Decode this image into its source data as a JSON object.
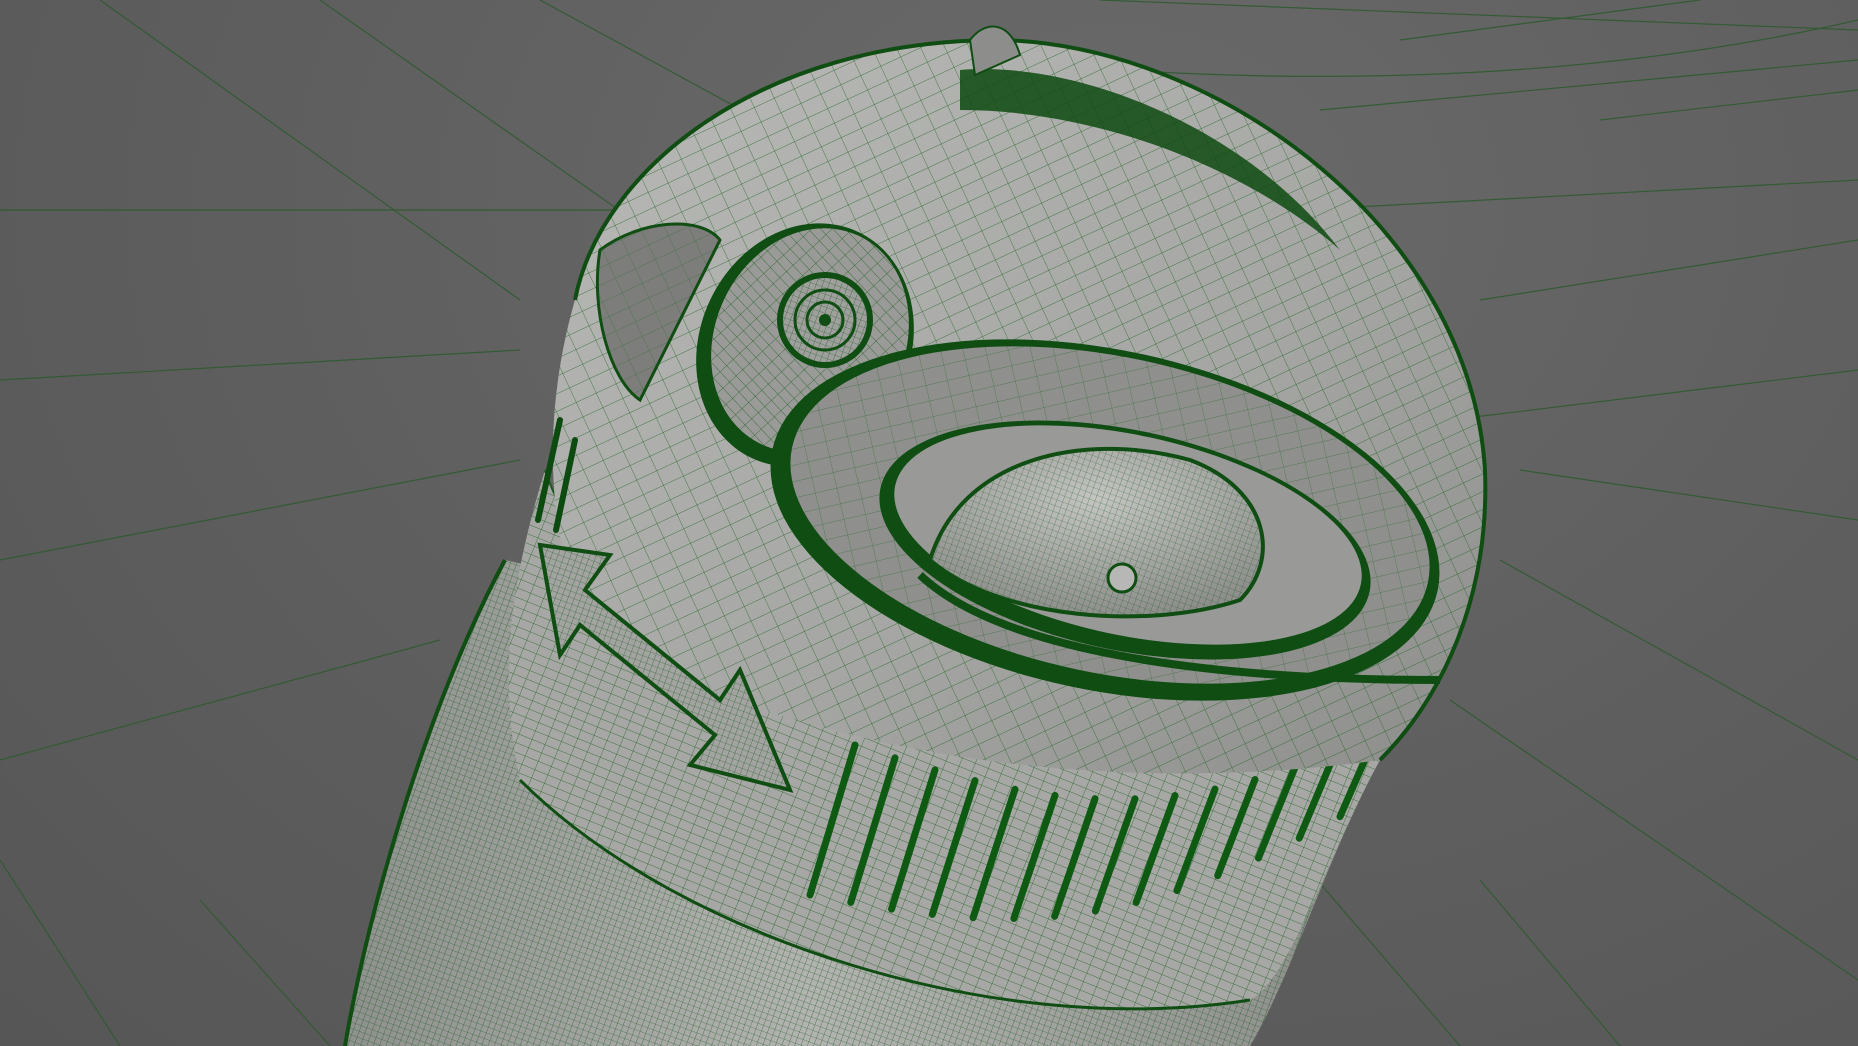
{
  "viewport": {
    "mode": "wireframe-on-shaded",
    "wire_color": "#0f5a12",
    "grid_color": "#2f5a2f",
    "background_color": "#5f5f5f",
    "surface_color": "#a9aaa7"
  },
  "model": {
    "parts": [
      "cylindrical-body",
      "top-cap",
      "lens-socket",
      "dome-recess",
      "tick-ring",
      "double-arrow-marker"
    ],
    "tick_marks": 14
  }
}
